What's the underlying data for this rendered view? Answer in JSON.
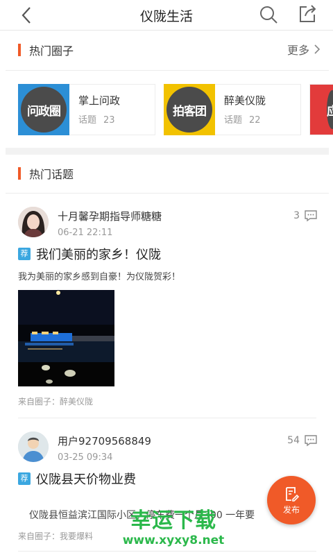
{
  "header": {
    "title": "仪陇生活"
  },
  "hot_circles": {
    "title": "热门圈子",
    "more_label": "更多",
    "items": [
      {
        "name": "掌上问政",
        "badge": "问政圈",
        "topic_label": "话题",
        "topic_count": "23",
        "bg": "#2c8fd6"
      },
      {
        "name": "醉美仪陇",
        "badge": "拍客团",
        "topic_label": "话题",
        "topic_count": "22",
        "bg": "#f2c200"
      },
      {
        "name": "",
        "badge": "应",
        "topic_label": "",
        "topic_count": "",
        "bg": "#e23b3b"
      }
    ]
  },
  "hot_topics": {
    "title": "热门话题",
    "posts": [
      {
        "author": "十月馨孕期指导师糖糖",
        "time": "06-21 22:11",
        "comment_count": "3",
        "tag": "荐",
        "title": "我们美丽的家乡！仪陇",
        "body": "我为美丽的家乡感到自豪！为仪陇贺彩！",
        "from": "来自圈子：醉美仪陇"
      },
      {
        "author": "用户92709568849",
        "time": "03-25 09:34",
        "comment_count": "54",
        "tag": "荐",
        "title": "仪陇县天价物业费",
        "body": "仪陇县恒益滨江国际小区，停车费一个月300 一年要",
        "from": "来自圈子：我要爆料"
      }
    ]
  },
  "fab": {
    "label": "发布"
  },
  "watermark": {
    "line1": "幸运下载",
    "line2": "www.xyxy8.net"
  },
  "colors": {
    "accent": "#f05a28",
    "tag": "#3ba7e0",
    "watermark": "#2bb84b"
  }
}
